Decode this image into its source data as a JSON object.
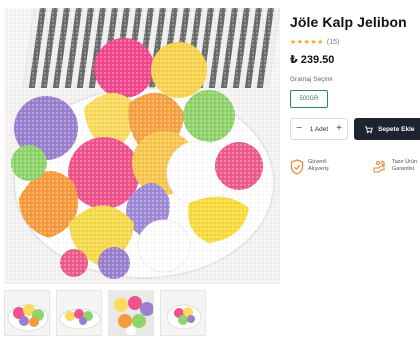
{
  "product": {
    "title": "Jöle Kalp Jelibon",
    "rating_stars": "★★★★★",
    "review_count": "(15)",
    "price": "₺ 239.50"
  },
  "options": {
    "weight_label": "Gramaj Seçimi",
    "selected_weight": "500GR"
  },
  "cart": {
    "quantity_minus": "−",
    "quantity_label": "1 Adet",
    "quantity_plus": "+",
    "add_to_cart_label": "Sepete Ekle"
  },
  "badges": [
    {
      "line1": "Güvenli",
      "line2": "Alışveriş",
      "icon": "shield-check-icon"
    },
    {
      "line1": "Taze Ürün",
      "line2": "Garantisi",
      "icon": "fresh-product-icon"
    }
  ],
  "colors": {
    "accent_green": "#2e8b57",
    "cart_button": "#1c2430",
    "star": "#f5a623",
    "badge_icon": "#e8842c"
  }
}
